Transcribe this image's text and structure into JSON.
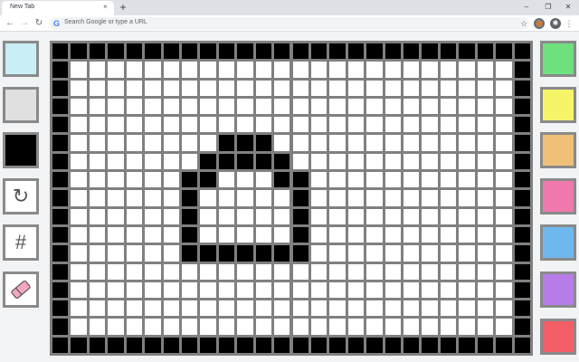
{
  "browser": {
    "tab_title": "New Tab",
    "tab_close_glyph": "×",
    "new_tab_glyph": "+",
    "window_controls": [
      "–",
      "❐",
      "✕"
    ],
    "back_glyph": "←",
    "forward_glyph": "→",
    "reload_glyph": "↻",
    "g_logo": "G",
    "omnibox_placeholder": "Search Google or type a URL",
    "star_glyph": "☆",
    "menu_glyph": "⋮",
    "extension_glyph": "✱"
  },
  "left_tools": [
    {
      "name": "color-light-cyan",
      "color": "#c9eef5",
      "icon": ""
    },
    {
      "name": "color-light-gray",
      "color": "#e0e0e0",
      "icon": ""
    },
    {
      "name": "color-black",
      "color": "#000000",
      "icon": ""
    },
    {
      "name": "rotate-button",
      "color": "#ffffff",
      "icon": "rotate-icon",
      "glyph": "↻"
    },
    {
      "name": "grid-toggle-button",
      "color": "#ffffff",
      "icon": "grid-icon",
      "glyph": "#"
    },
    {
      "name": "eraser-button",
      "color": "#ffffff",
      "icon": "eraser-icon",
      "glyph": ""
    }
  ],
  "right_palette": [
    {
      "name": "color-green",
      "color": "#6ee07d"
    },
    {
      "name": "color-yellow",
      "color": "#f7f46a"
    },
    {
      "name": "color-orange",
      "color": "#f0c078"
    },
    {
      "name": "color-pink",
      "color": "#f07aae"
    },
    {
      "name": "color-blue",
      "color": "#6fb8ee"
    },
    {
      "name": "color-purple",
      "color": "#b77ce8"
    },
    {
      "name": "color-red",
      "color": "#f45e66"
    }
  ],
  "grid": {
    "columns": 26,
    "rows": 17,
    "background_color": "#ffffff",
    "ink_color": "#000000",
    "line_color": "#808080",
    "black_cells": [
      [
        9,
        5
      ],
      [
        10,
        5
      ],
      [
        11,
        5
      ],
      [
        8,
        6
      ],
      [
        9,
        6
      ],
      [
        10,
        6
      ],
      [
        11,
        6
      ],
      [
        12,
        6
      ],
      [
        7,
        7
      ],
      [
        8,
        7
      ],
      [
        12,
        7
      ],
      [
        13,
        7
      ],
      [
        7,
        8
      ],
      [
        13,
        8
      ],
      [
        7,
        9
      ],
      [
        13,
        9
      ],
      [
        7,
        10
      ],
      [
        13,
        10
      ],
      [
        7,
        11
      ],
      [
        8,
        11
      ],
      [
        9,
        11
      ],
      [
        10,
        11
      ],
      [
        11,
        11
      ],
      [
        12,
        11
      ],
      [
        13,
        11
      ]
    ]
  }
}
